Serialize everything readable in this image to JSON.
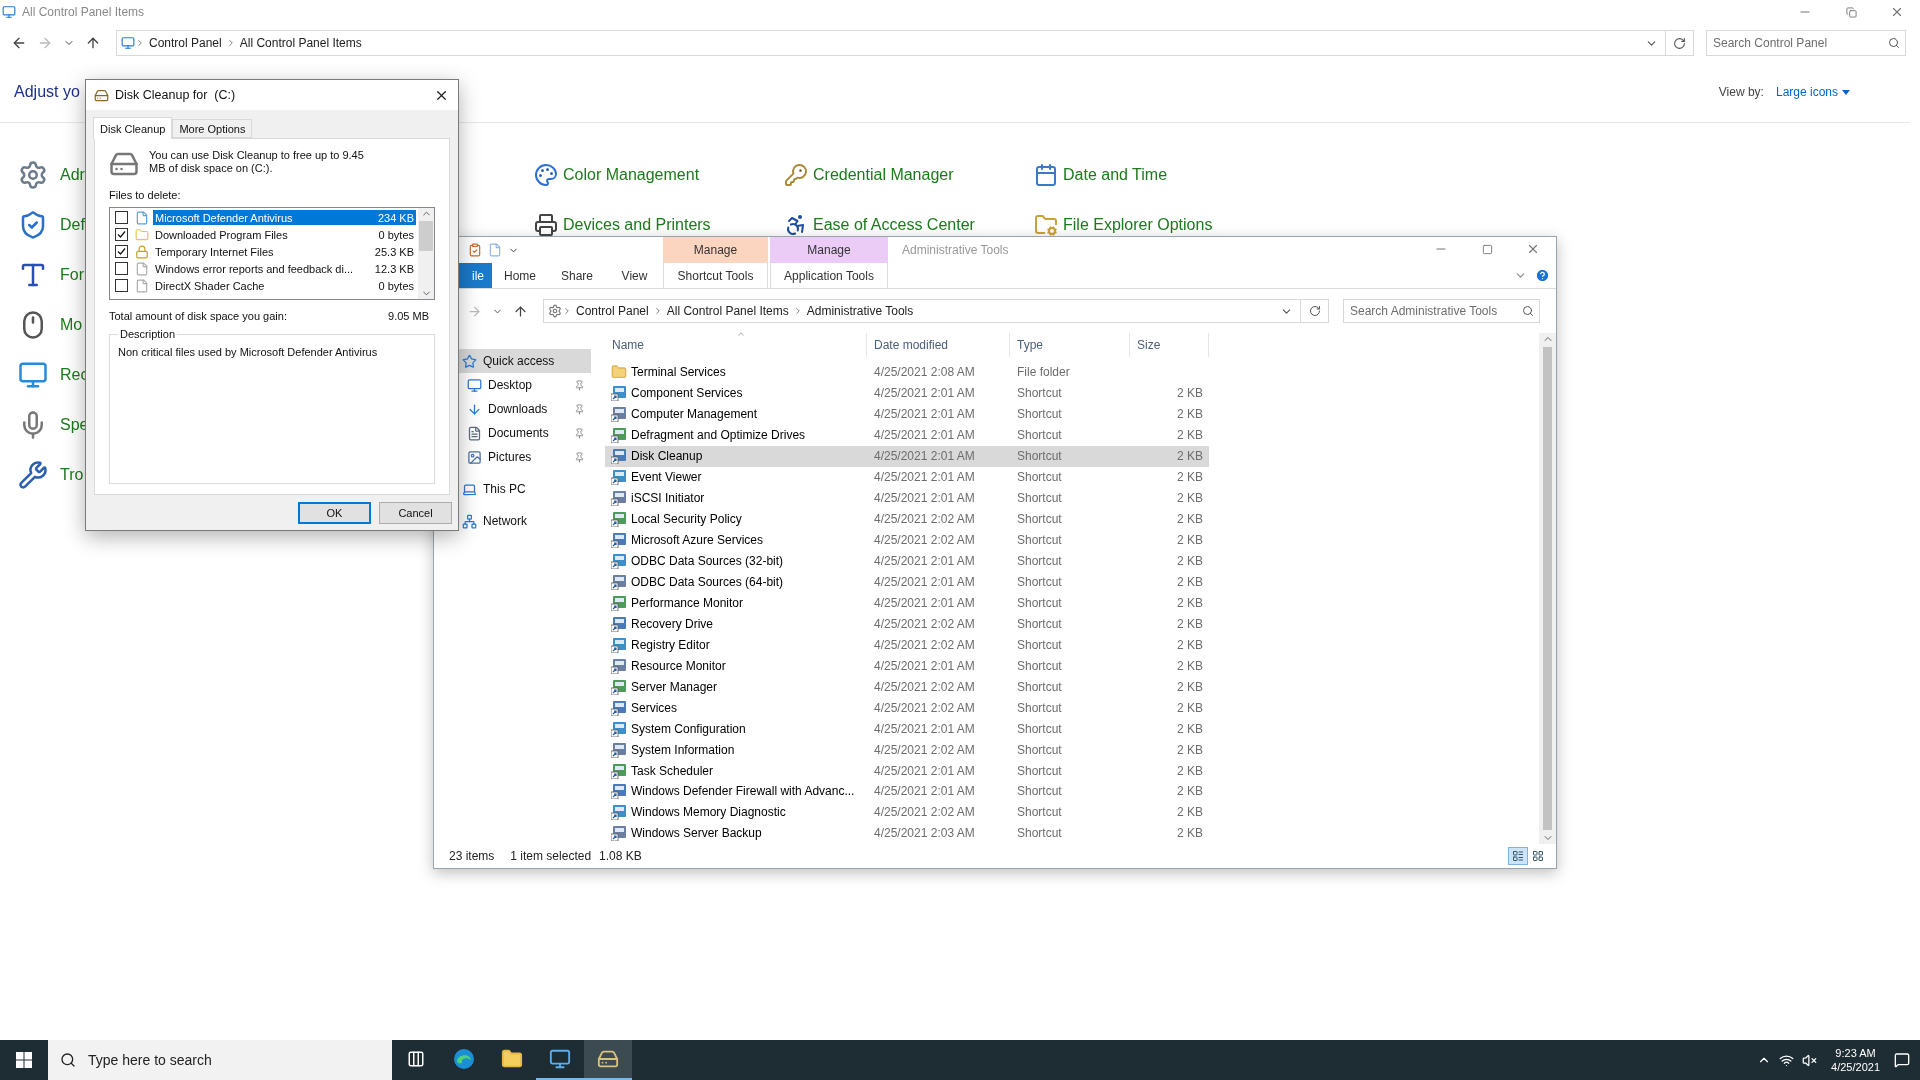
{
  "control_panel": {
    "title": "All Control Panel Items",
    "breadcrumb": [
      "Control Panel",
      "All Control Panel Items"
    ],
    "search": {
      "placeholder": "Search Control Panel"
    },
    "heading": "Adjust yo",
    "view_by_label": "View by:",
    "view_by_value": "Large icons",
    "left_items": [
      "Adr",
      "Def",
      "For",
      "Mo",
      "Rec",
      "Spe",
      "Tro"
    ],
    "items": [
      "Color Management",
      "Credential Manager",
      "Date and Time",
      "Devices and Printers",
      "Ease of Access Center",
      "File Explorer Options"
    ]
  },
  "explorer": {
    "title": "Administrative Tools",
    "context_tabs": [
      {
        "group": "Manage",
        "label": "Shortcut Tools",
        "color": "#fcd5c0"
      },
      {
        "group": "Manage",
        "label": "Application Tools",
        "color": "#ebccf7"
      }
    ],
    "ribbon_tabs": [
      {
        "label": "ile",
        "kind": "file"
      },
      {
        "label": "Home",
        "kind": "tab"
      },
      {
        "label": "Share",
        "kind": "tab"
      },
      {
        "label": "View",
        "kind": "tab"
      }
    ],
    "breadcrumb": [
      "Control Panel",
      "All Control Panel Items",
      "Administrative Tools"
    ],
    "search": {
      "placeholder": "Search Administrative Tools"
    },
    "nav": [
      {
        "label": "Quick access",
        "selected": true,
        "children": [
          {
            "label": "Desktop",
            "selected": false,
            "pinned": true
          },
          {
            "label": "Downloads",
            "selected": false,
            "pinned": true
          },
          {
            "label": "Documents",
            "selected": false,
            "pinned": true
          },
          {
            "label": "Pictures",
            "selected": false,
            "pinned": true
          }
        ]
      },
      {
        "label": "This PC",
        "selected": false
      },
      {
        "label": "Network",
        "selected": false
      }
    ],
    "columns": [
      "Name",
      "Date modified",
      "Type",
      "Size"
    ],
    "rows": [
      {
        "kind": "folder",
        "name": "Terminal Services",
        "date": "4/25/2021 2:08 AM",
        "type": "File folder",
        "selected": false
      },
      {
        "kind": "shortcut",
        "name": "Component Services",
        "date": "4/25/2021 2:01 AM",
        "type": "Shortcut",
        "size": "2 KB",
        "selected": false
      },
      {
        "kind": "shortcut",
        "name": "Computer Management",
        "date": "4/25/2021 2:01 AM",
        "type": "Shortcut",
        "size": "2 KB",
        "selected": false
      },
      {
        "kind": "shortcut",
        "name": "Defragment and Optimize Drives",
        "date": "4/25/2021 2:01 AM",
        "type": "Shortcut",
        "size": "2 KB",
        "selected": false
      },
      {
        "kind": "shortcut",
        "name": "Disk Cleanup",
        "date": "4/25/2021 2:01 AM",
        "type": "Shortcut",
        "size": "2 KB",
        "selected": true
      },
      {
        "kind": "shortcut",
        "name": "Event Viewer",
        "date": "4/25/2021 2:01 AM",
        "type": "Shortcut",
        "size": "2 KB",
        "selected": false
      },
      {
        "kind": "shortcut",
        "name": "iSCSI Initiator",
        "date": "4/25/2021 2:01 AM",
        "type": "Shortcut",
        "size": "2 KB",
        "selected": false
      },
      {
        "kind": "shortcut",
        "name": "Local Security Policy",
        "date": "4/25/2021 2:02 AM",
        "type": "Shortcut",
        "size": "2 KB",
        "selected": false
      },
      {
        "kind": "shortcut",
        "name": "Microsoft Azure Services",
        "date": "4/25/2021 2:02 AM",
        "type": "Shortcut",
        "size": "2 KB",
        "selected": false
      },
      {
        "kind": "shortcut",
        "name": "ODBC Data Sources (32-bit)",
        "date": "4/25/2021 2:01 AM",
        "type": "Shortcut",
        "size": "2 KB",
        "selected": false
      },
      {
        "kind": "shortcut",
        "name": "ODBC Data Sources (64-bit)",
        "date": "4/25/2021 2:01 AM",
        "type": "Shortcut",
        "size": "2 KB",
        "selected": false
      },
      {
        "kind": "shortcut",
        "name": "Performance Monitor",
        "date": "4/25/2021 2:01 AM",
        "type": "Shortcut",
        "size": "2 KB",
        "selected": false
      },
      {
        "kind": "shortcut",
        "name": "Recovery Drive",
        "date": "4/25/2021 2:02 AM",
        "type": "Shortcut",
        "size": "2 KB",
        "selected": false
      },
      {
        "kind": "shortcut",
        "name": "Registry Editor",
        "date": "4/25/2021 2:02 AM",
        "type": "Shortcut",
        "size": "2 KB",
        "selected": false
      },
      {
        "kind": "shortcut",
        "name": "Resource Monitor",
        "date": "4/25/2021 2:01 AM",
        "type": "Shortcut",
        "size": "2 KB",
        "selected": false
      },
      {
        "kind": "shortcut",
        "name": "Server Manager",
        "date": "4/25/2021 2:02 AM",
        "type": "Shortcut",
        "size": "2 KB",
        "selected": false
      },
      {
        "kind": "shortcut",
        "name": "Services",
        "date": "4/25/2021 2:02 AM",
        "type": "Shortcut",
        "size": "2 KB",
        "selected": false
      },
      {
        "kind": "shortcut",
        "name": "System Configuration",
        "date": "4/25/2021 2:01 AM",
        "type": "Shortcut",
        "size": "2 KB",
        "selected": false
      },
      {
        "kind": "shortcut",
        "name": "System Information",
        "date": "4/25/2021 2:02 AM",
        "type": "Shortcut",
        "size": "2 KB",
        "selected": false
      },
      {
        "kind": "shortcut",
        "name": "Task Scheduler",
        "date": "4/25/2021 2:01 AM",
        "type": "Shortcut",
        "size": "2 KB",
        "selected": false
      },
      {
        "kind": "shortcut",
        "name": "Windows Defender Firewall with Advanc...",
        "date": "4/25/2021 2:01 AM",
        "type": "Shortcut",
        "size": "2 KB",
        "selected": false
      },
      {
        "kind": "shortcut",
        "name": "Windows Memory Diagnostic",
        "date": "4/25/2021 2:02 AM",
        "type": "Shortcut",
        "size": "2 KB",
        "selected": false
      },
      {
        "kind": "shortcut",
        "name": "Windows Server Backup",
        "date": "4/25/2021 2:03 AM",
        "type": "Shortcut",
        "size": "2 KB",
        "selected": false
      }
    ],
    "status": {
      "count": "23 items",
      "selection": "1 item selected",
      "selection_size": "1.08 KB"
    }
  },
  "disk_cleanup": {
    "title": "Disk Cleanup for  (C:)",
    "tabs": [
      {
        "label": "Disk Cleanup",
        "selected": true
      },
      {
        "label": "More Options",
        "selected": false
      }
    ],
    "intro": "You can use Disk Cleanup to free up to 9.45 MB of disk space on  (C:).",
    "files_label": "Files to delete:",
    "files": [
      {
        "name": "Microsoft Defender Antivirus",
        "size": "234 KB",
        "checked": false,
        "selected": true
      },
      {
        "name": "Downloaded Program Files",
        "size": "0 bytes",
        "checked": true,
        "selected": false
      },
      {
        "name": "Temporary Internet Files",
        "size": "25.3 KB",
        "checked": true,
        "selected": false
      },
      {
        "name": "Windows error reports and feedback di...",
        "size": "12.3 KB",
        "checked": false,
        "selected": false
      },
      {
        "name": "DirectX Shader Cache",
        "size": "0 bytes",
        "checked": false,
        "selected": false
      }
    ],
    "total_label": "Total amount of disk space you gain:",
    "total_value": "9.05 MB",
    "description_label": "Description",
    "description": "Non critical files used by Microsoft Defender Antivirus",
    "buttons": [
      {
        "label": "OK",
        "default": true
      },
      {
        "label": "Cancel",
        "default": false
      }
    ]
  },
  "taskbar": {
    "search": {
      "placeholder": "Type here to search"
    },
    "apps": [
      {
        "running": false,
        "active": false
      },
      {
        "running": false,
        "active": false
      },
      {
        "running": true,
        "active": false
      },
      {
        "running": true,
        "active": true
      }
    ],
    "time": "9:23 AM",
    "date": "4/25/2021"
  }
}
